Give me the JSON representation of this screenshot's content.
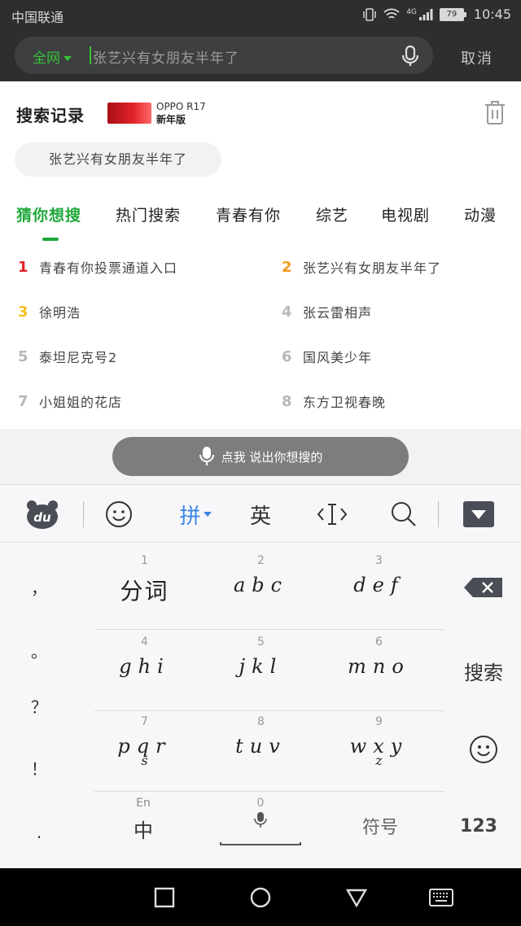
{
  "status_bar": {
    "carrier": "中国联通",
    "network": "4G",
    "battery": "79",
    "time": "10:45"
  },
  "search": {
    "scope": "全网",
    "query": "张艺兴有女朋友半年了",
    "cancel_label": "取消"
  },
  "history": {
    "title": "搜索记录",
    "ad": {
      "brand": "OPPO R17",
      "tag": "新年版"
    },
    "items": [
      "张艺兴有女朋友半年了"
    ]
  },
  "tabs": [
    "猜你想搜",
    "热门搜索",
    "青春有你",
    "综艺",
    "电视剧",
    "动漫"
  ],
  "hot_list": [
    {
      "rank": "1",
      "name": "青春有你投票通道入口",
      "color": "#e0202a"
    },
    {
      "rank": "2",
      "name": "张艺兴有女朋友半年了",
      "color": "#f39a1e"
    },
    {
      "rank": "3",
      "name": "徐明浩",
      "color": "#f3c21e"
    },
    {
      "rank": "4",
      "name": "张云雷相声",
      "color": "#b8b8b8"
    },
    {
      "rank": "5",
      "name": "泰坦尼克号2",
      "color": "#b8b8b8"
    },
    {
      "rank": "6",
      "name": "国风美少年",
      "color": "#b8b8b8"
    },
    {
      "rank": "7",
      "name": "小姐姐的花店",
      "color": "#b8b8b8"
    },
    {
      "rank": "8",
      "name": "东方卫视春晚",
      "color": "#b8b8b8"
    }
  ],
  "voice_button": "点我 说出你想搜的",
  "keyboard": {
    "toolbar": {
      "pinyin": "拼",
      "english": "英"
    },
    "punctuation": [
      "，",
      "。",
      "？",
      "！",
      "."
    ],
    "keys": [
      {
        "num": "1",
        "letters": "分词"
      },
      {
        "num": "2",
        "letters": "abc"
      },
      {
        "num": "3",
        "letters": "def"
      },
      {
        "num": "4",
        "letters": "ghi"
      },
      {
        "num": "5",
        "letters": "jkl"
      },
      {
        "num": "6",
        "letters": "mno"
      },
      {
        "num": "7",
        "letters": "pqr",
        "extra": "s"
      },
      {
        "num": "8",
        "letters": "tuv"
      },
      {
        "num": "9",
        "letters": "wxy",
        "extra": "z"
      }
    ],
    "search_label": "搜索",
    "bottom": {
      "lang_small": "En",
      "lang": "中",
      "space_num": "0",
      "symbols": "符号",
      "numbers": "123"
    }
  },
  "colors": {
    "accent": "#1fa83a",
    "header_bg": "#2d2e2f",
    "blue": "#3a86e8"
  }
}
